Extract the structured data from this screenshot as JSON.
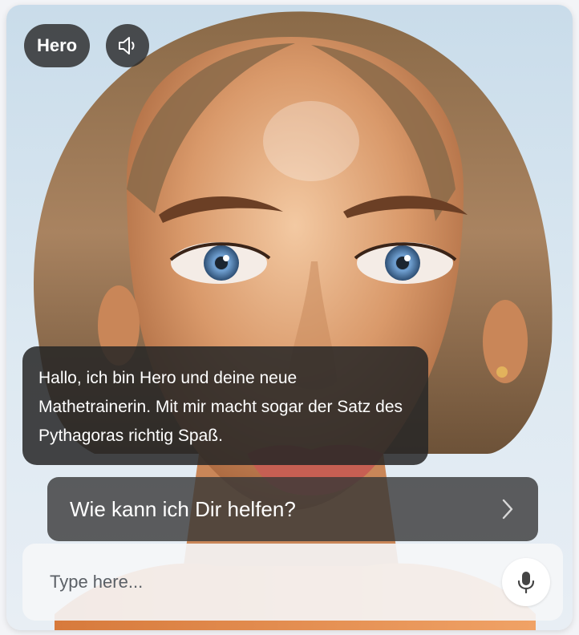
{
  "header": {
    "name_badge": "Hero",
    "sound_icon": "speaker-icon"
  },
  "avatar": {
    "description_icon": "avatar-portrait"
  },
  "chat": {
    "message": "Hallo, ich bin Hero und deine neue Mathetrainerin. Mit mir macht sogar der Satz des Pythagoras richtig Spaß."
  },
  "suggestion": {
    "label": "Wie kann ich Dir helfen?",
    "icon": "chevron-right-icon"
  },
  "input": {
    "placeholder": "Type here...",
    "value": "",
    "mic_icon": "microphone-icon"
  },
  "colors": {
    "overlay_dark": "#262626",
    "input_bg": "#f5f6f8",
    "text_light": "#ffffff"
  }
}
